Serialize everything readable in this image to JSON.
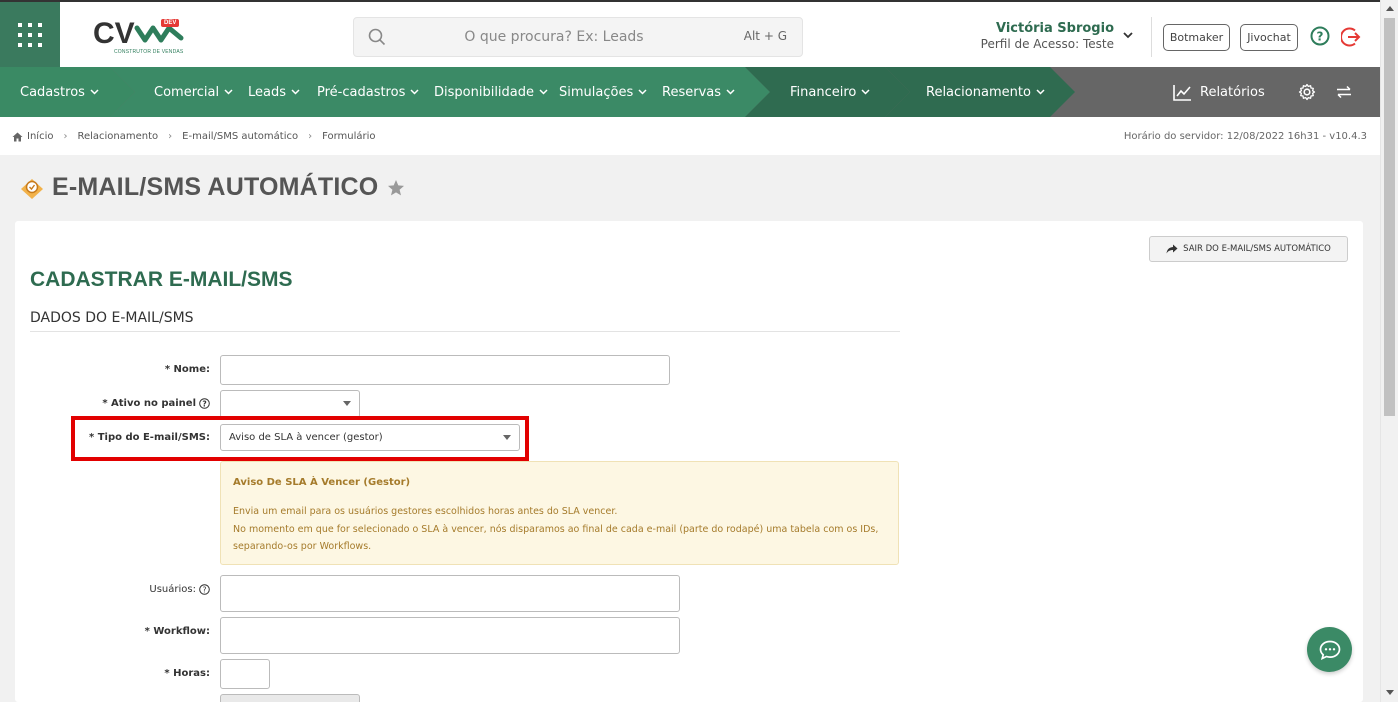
{
  "header": {
    "logo_text": "CV",
    "logo_badge": "DEV",
    "logo_subtitle": "CONSTRUTOR DE VENDAS",
    "search_placeholder": "O que procura? Ex: Leads",
    "search_shortcut": "Alt + G",
    "user_name": "Victória Sbrogio",
    "user_profile": "Perfil de Acesso: Teste",
    "botmaker_label": "Botmaker",
    "jivochat_label": "Jivochat"
  },
  "nav": {
    "items": [
      {
        "label": "Cadastros"
      },
      {
        "label": "Comercial"
      },
      {
        "label": "Leads"
      },
      {
        "label": "Pré-cadastros"
      },
      {
        "label": "Disponibilidade"
      },
      {
        "label": "Simulações"
      },
      {
        "label": "Reservas"
      },
      {
        "label": "Financeiro"
      },
      {
        "label": "Relacionamento"
      }
    ],
    "reports_label": "Relatórios"
  },
  "breadcrumb": {
    "items": [
      "Início",
      "Relacionamento",
      "E-mail/SMS automático",
      "Formulário"
    ],
    "server_time": "Horário do servidor: 12/08/2022 16h31 - v10.4.3"
  },
  "page": {
    "title": "E-MAIL/SMS AUTOMÁTICO",
    "exit_button": "SAIR DO E-MAIL/SMS AUTOMÁTICO",
    "form_title": "CADASTRAR E-MAIL/SMS",
    "section_title": "DADOS DO E-MAIL/SMS"
  },
  "form": {
    "nome_label": "* Nome:",
    "nome_value": "",
    "ativo_label": "* Ativo no painel",
    "ativo_value": "",
    "tipo_label": "* Tipo do E-mail/SMS:",
    "tipo_value": "Aviso de SLA à vencer (gestor)",
    "info_title": "Aviso De SLA À Vencer (Gestor)",
    "info_line1": "Envia um email para os usuários gestores escolhidos horas antes do SLA vencer.",
    "info_line2": "No momento em que for selecionado o SLA à vencer, nós disparamos ao final de cada e-mail (parte do rodapé) uma tabela com os IDs, separando-os por Workflows.",
    "usuarios_label": "Usuários:",
    "workflow_label": "* Workflow:",
    "horas_label": "* Horas:"
  },
  "colors": {
    "brand_green": "#3a7a5e",
    "nav_dark_green": "#2f6b50",
    "nav_grey": "#666666",
    "highlight_red": "#e20000",
    "info_bg": "#fdf7e3"
  }
}
